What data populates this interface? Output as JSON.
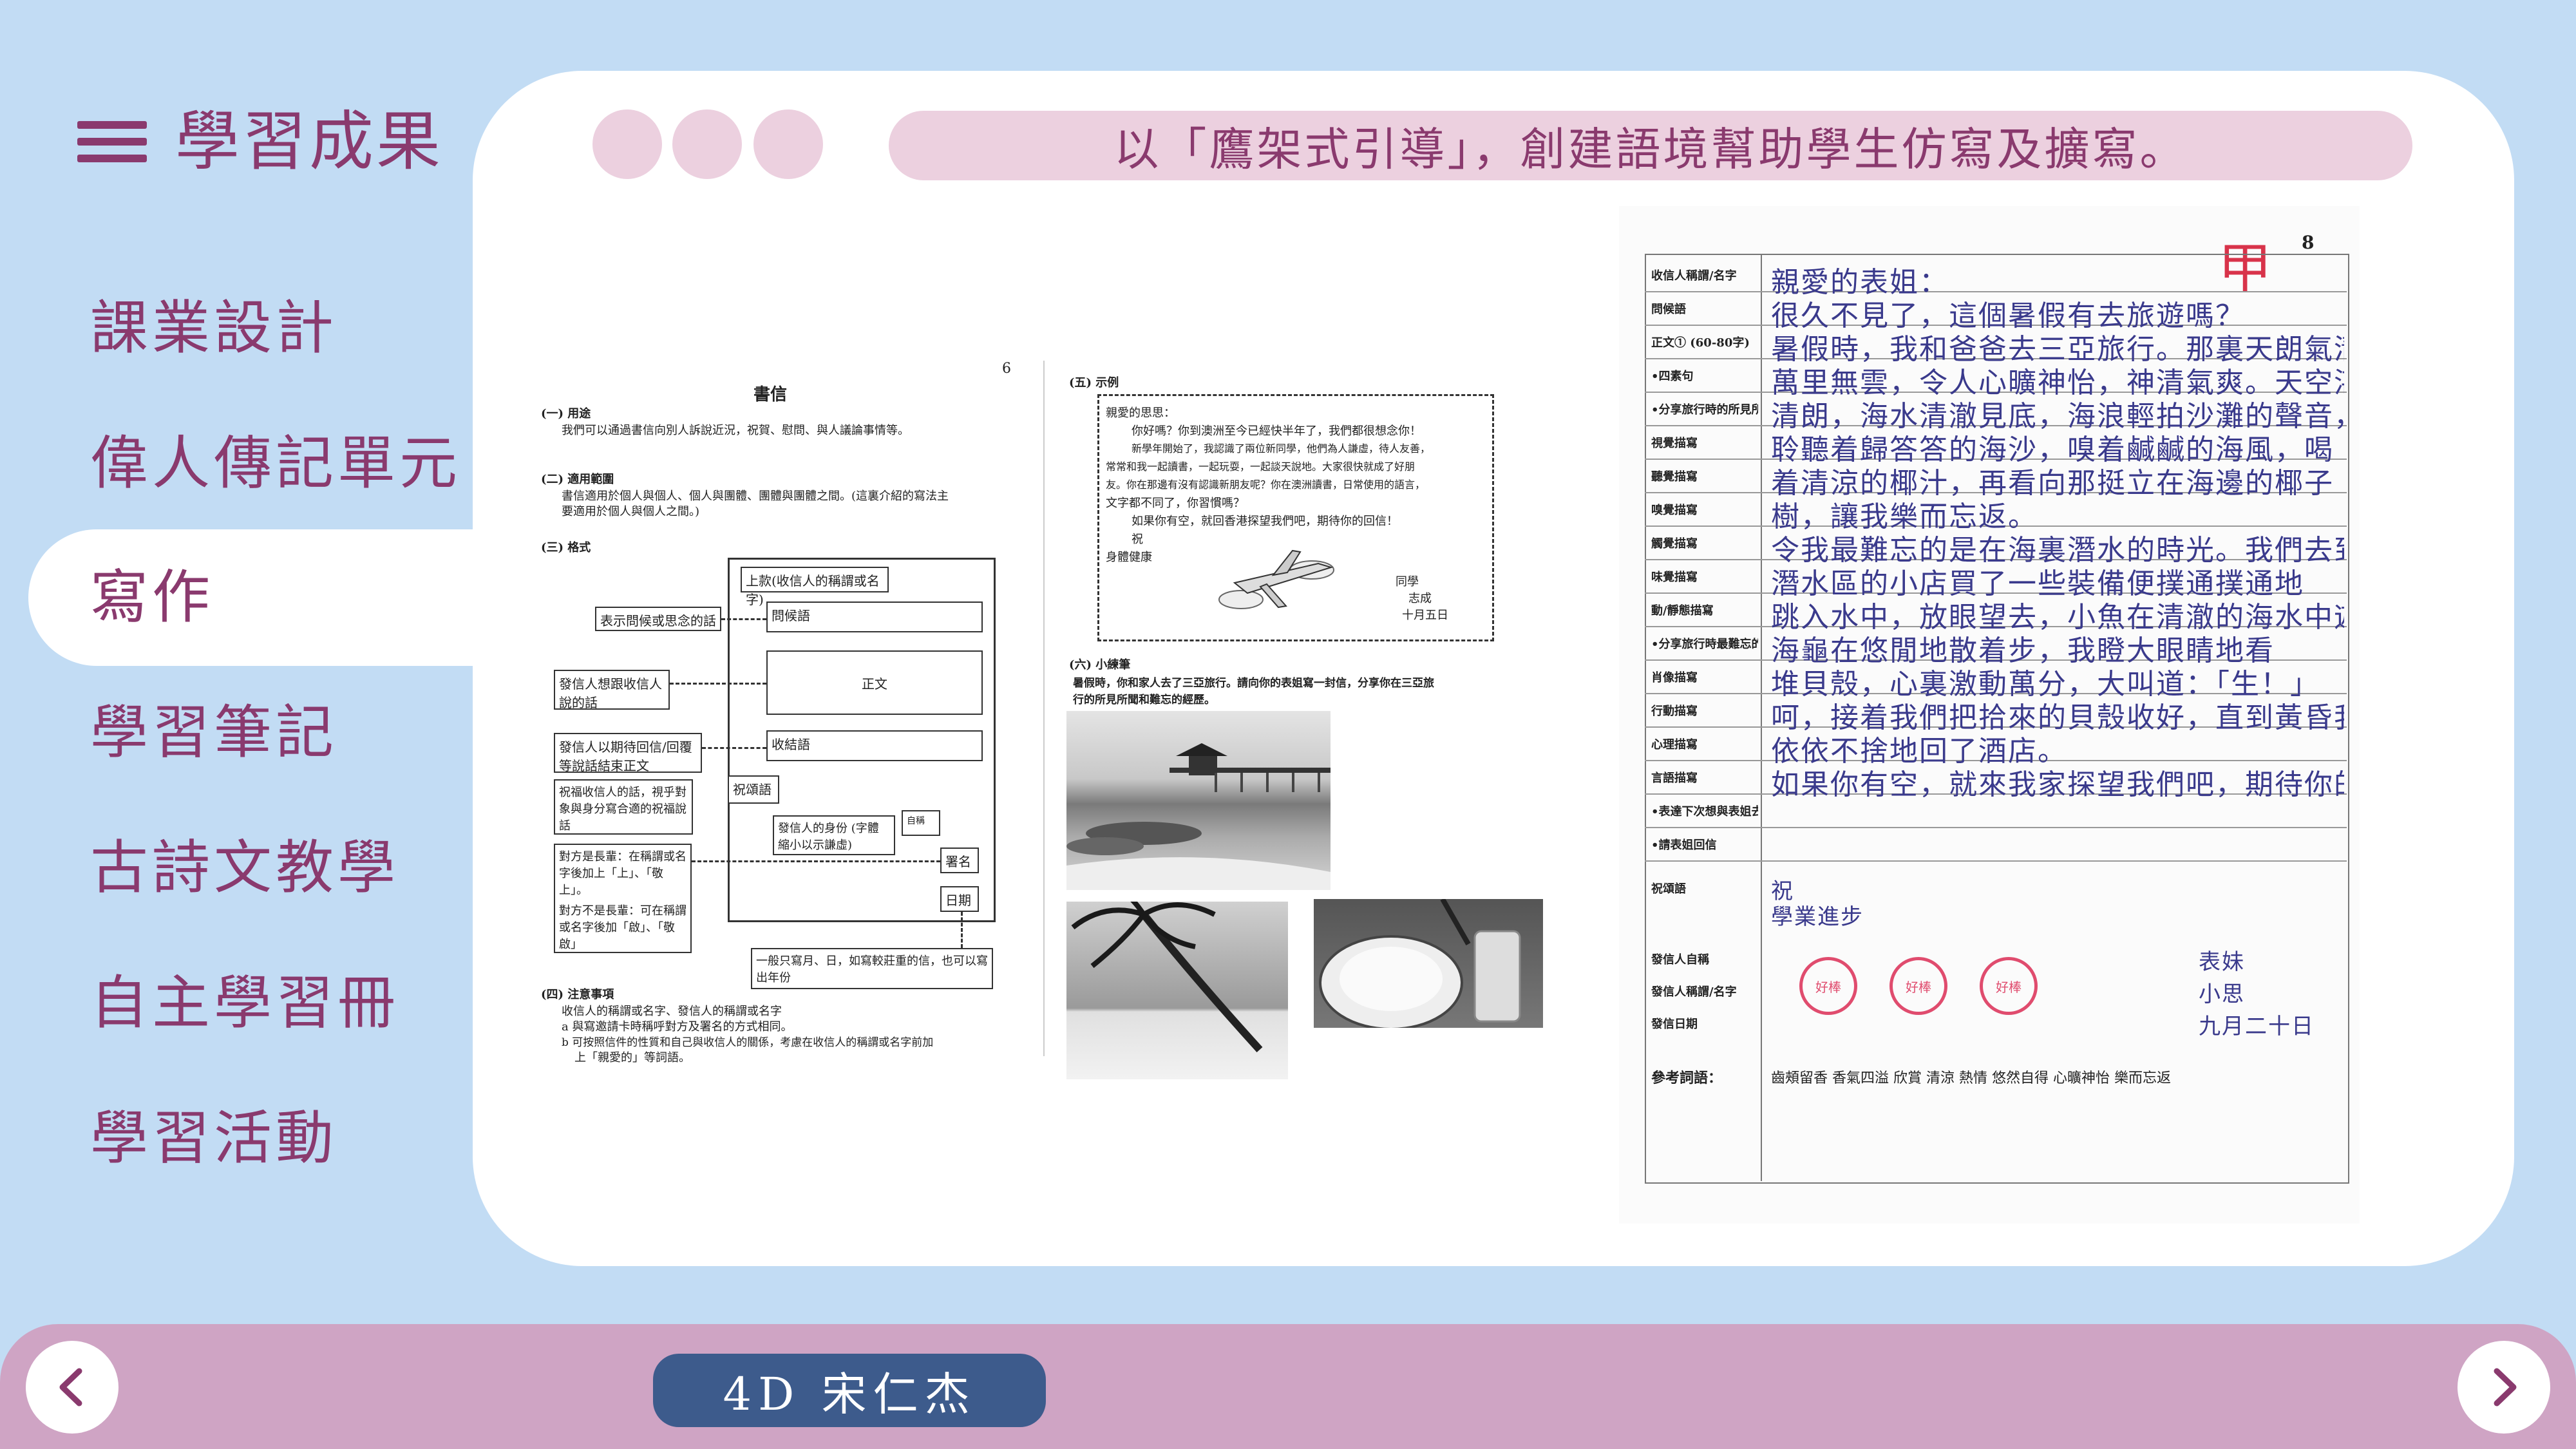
{
  "sidebar": {
    "title": "學習成果",
    "items": [
      {
        "label": "課業設計"
      },
      {
        "label": "偉人傳記單元"
      },
      {
        "label": "寫作"
      },
      {
        "label": "學習筆記"
      },
      {
        "label": "古詩文教學"
      },
      {
        "label": "自主學習冊"
      },
      {
        "label": "學習活動"
      }
    ],
    "active_index": 2
  },
  "main": {
    "banner": "以「鷹架式引導」，創建語境幫助學生仿寫及擴寫。",
    "worksheet_left": {
      "page_number": "6",
      "title": "書信",
      "sec1_head": "(一) 用途",
      "sec1_text": "我們可以通過書信向別人訴說近況，祝賀、慰問、與人議論事情等。",
      "sec2_head": "(二) 適用範圍",
      "sec2_text1": "書信適用於個人與個人、個人與團體、團體與團體之間。(這裏介紹的寫法主",
      "sec2_text2": "要適用於個人與個人之間。)",
      "sec3_head": "(三) 格式",
      "box_recipient": "上款(收信人的稱謂或名字)",
      "box_greeting": "問候語",
      "box_body": "正文",
      "box_closing": "收結語",
      "box_wish": "祝頌語",
      "box_sender": "自稱",
      "box_name": "署名",
      "box_date": "日期",
      "lbl_greeting": "表示問候或思念的話",
      "lbl_body": "發信人想跟收信人說的話",
      "lbl_closing": "發信人以期待回信/回覆等說話結束正文",
      "lbl_wish": "祝福收信人的話，視乎對象與身分寫合適的祝福說話",
      "lbl_sender_id": "發信人的身份 (字體縮小以示謙虛)",
      "lbl_elder": "對方是長輩：在稱謂或名字後加上「上」、「敬上」。",
      "lbl_peer": "對方不是長輩：可在稱謂或名字後加「啟」、「敬啟」",
      "lbl_date": "一般只寫月、日，如寫較莊重的信，也可以寫出年份",
      "sec4_head": "(四) 注意事項",
      "sec4_text1": "收信人的稱謂或名字、發信人的稱謂或名字",
      "sec4_text2": "a 與寫邀請卡時稱呼對方及署名的方式相同。",
      "sec4_text3": "b 可按照信件的性質和自己與收信人的關係，考慮在收信人的稱謂或名字前加",
      "sec4_text4": "上「親愛的」等詞語。",
      "sec5_head": "(五) 示例",
      "example_1": "親愛的思思：",
      "example_2": "你好嗎？你到澳洲至今已經快半年了，我們都很想念你！",
      "example_3": "新學年開始了，我認識了兩位新同學，他們為人謙虛，待人友善，",
      "example_4": "常常和我一起讀書，一起玩耍，一起談天說地。大家很快就成了好朋",
      "example_5": "友。你在那邊有沒有認識新朋友呢？你在澳洲讀書，日常使用的語言，",
      "example_6": "文字都不同了，你習慣嗎？",
      "example_7": "如果你有空，就回香港探望我們吧，期待你的回信！",
      "example_8": "祝",
      "example_9": "身體健康",
      "example_10": "同學",
      "example_11": "志成",
      "example_12": "十月五日",
      "sec6_head": "(六) 小練筆",
      "sec6_text1": "暑假時，你和家人去了三亞旅行。請向你的表姐寫一封信，分享你在三亞旅",
      "sec6_text2": "行的所見所聞和難忘的經歷。"
    },
    "worksheet_right": {
      "page_number": "8",
      "grade_mark": "甲",
      "rows": [
        {
          "label": "收信人稱謂/名字",
          "hand": "親愛的表姐："
        },
        {
          "label": "問候語",
          "hand": "很久不見了，這個暑假有去旅遊嗎？"
        },
        {
          "label": "正文① (60-80字)",
          "hand": "暑假時，我和爸爸去三亞旅行。那裏天朗氣清，"
        },
        {
          "label": "•四素句",
          "hand": "萬里無雲，令人心曠神怡，神清氣爽。天空湛藍，"
        },
        {
          "label": "•分享旅行時的所見所聞",
          "hand": "清朗，海水清澈見底，海浪輕拍沙灘的聲音，"
        },
        {
          "label": "視覺描寫",
          "hand": "聆聽着歸答答的海沙，嗅着鹹鹹的海風，喝"
        },
        {
          "label": "聽覺描寫",
          "hand": "着清涼的椰汁，再看向那挺立在海邊的椰子"
        },
        {
          "label": "嗅覺描寫",
          "hand": "樹，讓我樂而忘返。"
        },
        {
          "label": "觸覺描寫",
          "hand": "令我最難忘的是在海裏潛水的時光。我們去到"
        },
        {
          "label": "味覺描寫",
          "hand": "潛水區的小店買了一些裝備便撲通撲通地"
        },
        {
          "label": "動/靜態描寫",
          "hand": "跳入水中，放眼望去，小魚在清澈的海水中遊來遊"
        },
        {
          "label": "•分享旅行時最難忘的片段/活動",
          "hand": "海龜在悠閒地散着步，我瞪大眼睛地看"
        },
        {
          "label": "肖像描寫",
          "hand": "堆貝殼，心裏激動萬分，大叫道：「生！」"
        },
        {
          "label": "行動描寫",
          "hand": "呵，接着我們把拾來的貝殼收好，直到黃昏我們才"
        },
        {
          "label": "心理描寫",
          "hand": "依依不捨地回了酒店。"
        },
        {
          "label": "言語描寫",
          "hand": "如果你有空，就來我家探望我們吧，期待你的回信！"
        },
        {
          "label": "•表達下次想與表姐去旅行",
          "hand": ""
        },
        {
          "label": "•請表姐回信",
          "hand": ""
        }
      ],
      "wish_label": "祝頌語",
      "wish_1": "祝",
      "wish_2": "學業進步",
      "sender_self_label": "發信人自稱",
      "sender_self": "表妹",
      "sender_name_label": "發信人稱謂/名字",
      "sender_name": "小思",
      "date_label": "發信日期",
      "date": "九月二十日",
      "vocab_label": "參考詞語：",
      "vocab": "齒頰留香 香氣四溢 欣賞 清涼 熱情 悠然自得 心曠神怡 樂而忘返",
      "stamp_text": "好棒"
    }
  },
  "footer": {
    "student_name": "4D 宋仁杰",
    "prev_icon": "chevron-left-icon",
    "next_icon": "chevron-right-icon"
  },
  "colors": {
    "background": "#c2dcf4",
    "accent": "#8a3a6e",
    "banner_bg": "#ecd0df",
    "footer_bg": "#cfa4c4",
    "name_pill": "#3d5b8c"
  }
}
